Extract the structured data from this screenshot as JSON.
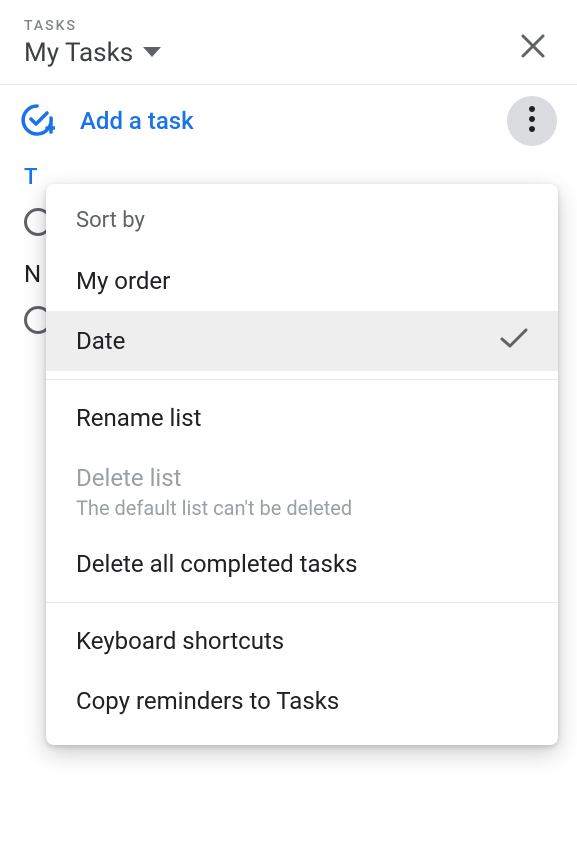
{
  "header": {
    "label": "TASKS",
    "list_name": "My Tasks"
  },
  "toolbar": {
    "add_task_label": "Add a task"
  },
  "content": {
    "section_date": "T",
    "nodate_label": "N"
  },
  "menu": {
    "sort_by_label": "Sort by",
    "my_order": "My order",
    "date": "Date",
    "rename_list": "Rename list",
    "delete_list": "Delete list",
    "delete_list_sub": "The default list can't be deleted",
    "delete_completed": "Delete all completed tasks",
    "keyboard_shortcuts": "Keyboard shortcuts",
    "copy_reminders": "Copy reminders to Tasks"
  }
}
